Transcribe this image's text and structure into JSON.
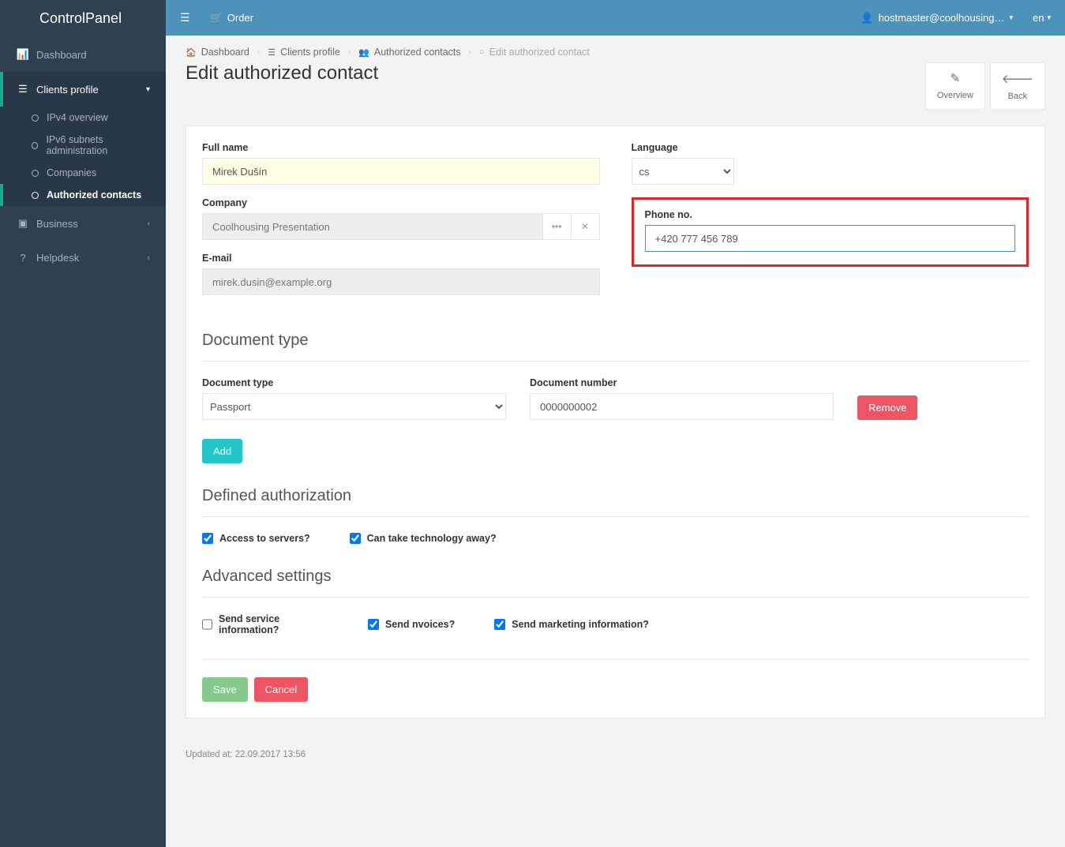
{
  "brand": "ControlPanel",
  "topbar": {
    "order": "Order",
    "user": "hostmaster@coolhousing…",
    "lang": "en"
  },
  "sidebar": {
    "dashboard": "Dashboard",
    "clients_profile": "Clients profile",
    "ipv4": "IPv4 overview",
    "ipv6": "IPv6 subnets administration",
    "companies": "Companies",
    "auth_contacts": "Authorized contacts",
    "business": "Business",
    "helpdesk": "Helpdesk"
  },
  "breadcrumbs": {
    "dashboard": "Dashboard",
    "clients_profile": "Clients profile",
    "auth_contacts": "Authorized contacts",
    "current": "Edit authorized contact"
  },
  "heading": "Edit authorized contact",
  "actions": {
    "overview": "Overview",
    "back": "Back"
  },
  "form": {
    "full_name_label": "Full name",
    "full_name": "Mirek Dušín",
    "company_label": "Company",
    "company": "Coolhousing Presentation",
    "email_label": "E-mail",
    "email": "mirek.dusin@example.org",
    "language_label": "Language",
    "language": "cs",
    "phone_label": "Phone no.",
    "phone": "+420 777 456 789"
  },
  "doc": {
    "section": "Document type",
    "type_label": "Document type",
    "type": "Passport",
    "number_label": "Document number",
    "number": "0000000002",
    "remove": "Remove",
    "add": "Add"
  },
  "auth": {
    "section": "Defined authorization",
    "access": "Access to servers?",
    "take_away": "Can take technology away?"
  },
  "adv": {
    "section": "Advanced settings",
    "service": "Send service information?",
    "invoices": "Send nvoices?",
    "marketing": "Send marketing information?"
  },
  "buttons": {
    "save": "Save",
    "cancel": "Cancel"
  },
  "footer": "Updated at: 22.09.2017 13:56"
}
